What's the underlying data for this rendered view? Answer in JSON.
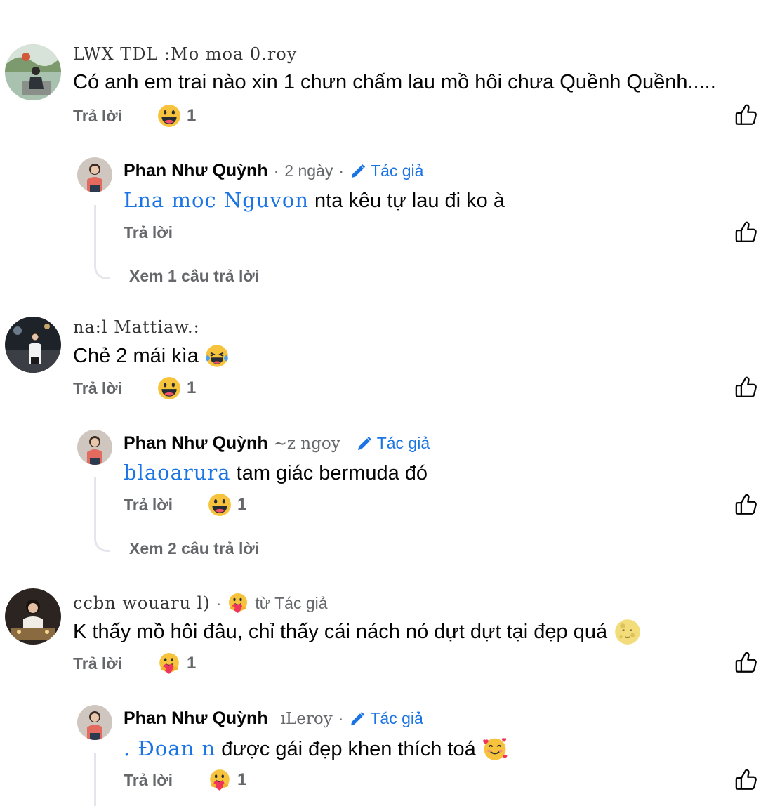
{
  "ui": {
    "reply_label": "Trả lời",
    "author_label": "Tác giả",
    "dot": "·"
  },
  "comments": [
    {
      "author_garbled": "LWX TDL :Mo moa 0.roy",
      "text": "Có anh em trai nào xin 1 chưn chấm lau mồ hôi chưa Quềnh Quềnh.....",
      "reaction_count": "1",
      "reply": {
        "author": "Phan Như Quỳnh",
        "time": "2 ngày",
        "mention": "Lna moc Nguvon",
        "text": " nta kêu tự lau đi ko à",
        "view_more": "Xem 1 câu trả lời"
      }
    },
    {
      "author_garbled": "na:l Mattiaw.:",
      "text": "Chẻ 2 mái kìa",
      "reaction_count": "1",
      "reply": {
        "author": "Phan Như Quỳnh",
        "time_garbled": "~z ngoy",
        "mention": "blaoarura",
        "text": " tam giác bermuda đó",
        "reaction_count": "1",
        "view_more": "Xem 2 câu trả lời"
      }
    },
    {
      "author_garbled": "ccbn wouaru l)",
      "from_author": "từ Tác giả",
      "text": "K thấy mồ hôi đâu, chỉ thấy cái nách nó dựt dựt tại đẹp quá",
      "reaction_count": "1",
      "reply": {
        "author": "Phan Như Quỳnh",
        "time_garbled": "ıLeroy",
        "mention": ". Đoan n",
        "text": " được gái đẹp khen thích toá",
        "reaction_count": "1"
      }
    }
  ],
  "icons": {
    "like": "thumbs-up-outline-icon",
    "edit": "pencil-icon",
    "haha": "grinning-emoji-icon",
    "care": "hugging-heart-emoji-icon",
    "laugh_tears": "face-with-tears-of-joy-icon",
    "moon": "full-moon-face-icon",
    "love": "smiling-face-with-hearts-icon"
  },
  "colors": {
    "link_blue": "#1b74e4",
    "secondary_text": "#65676b",
    "thread_line": "#e4e6eb"
  }
}
